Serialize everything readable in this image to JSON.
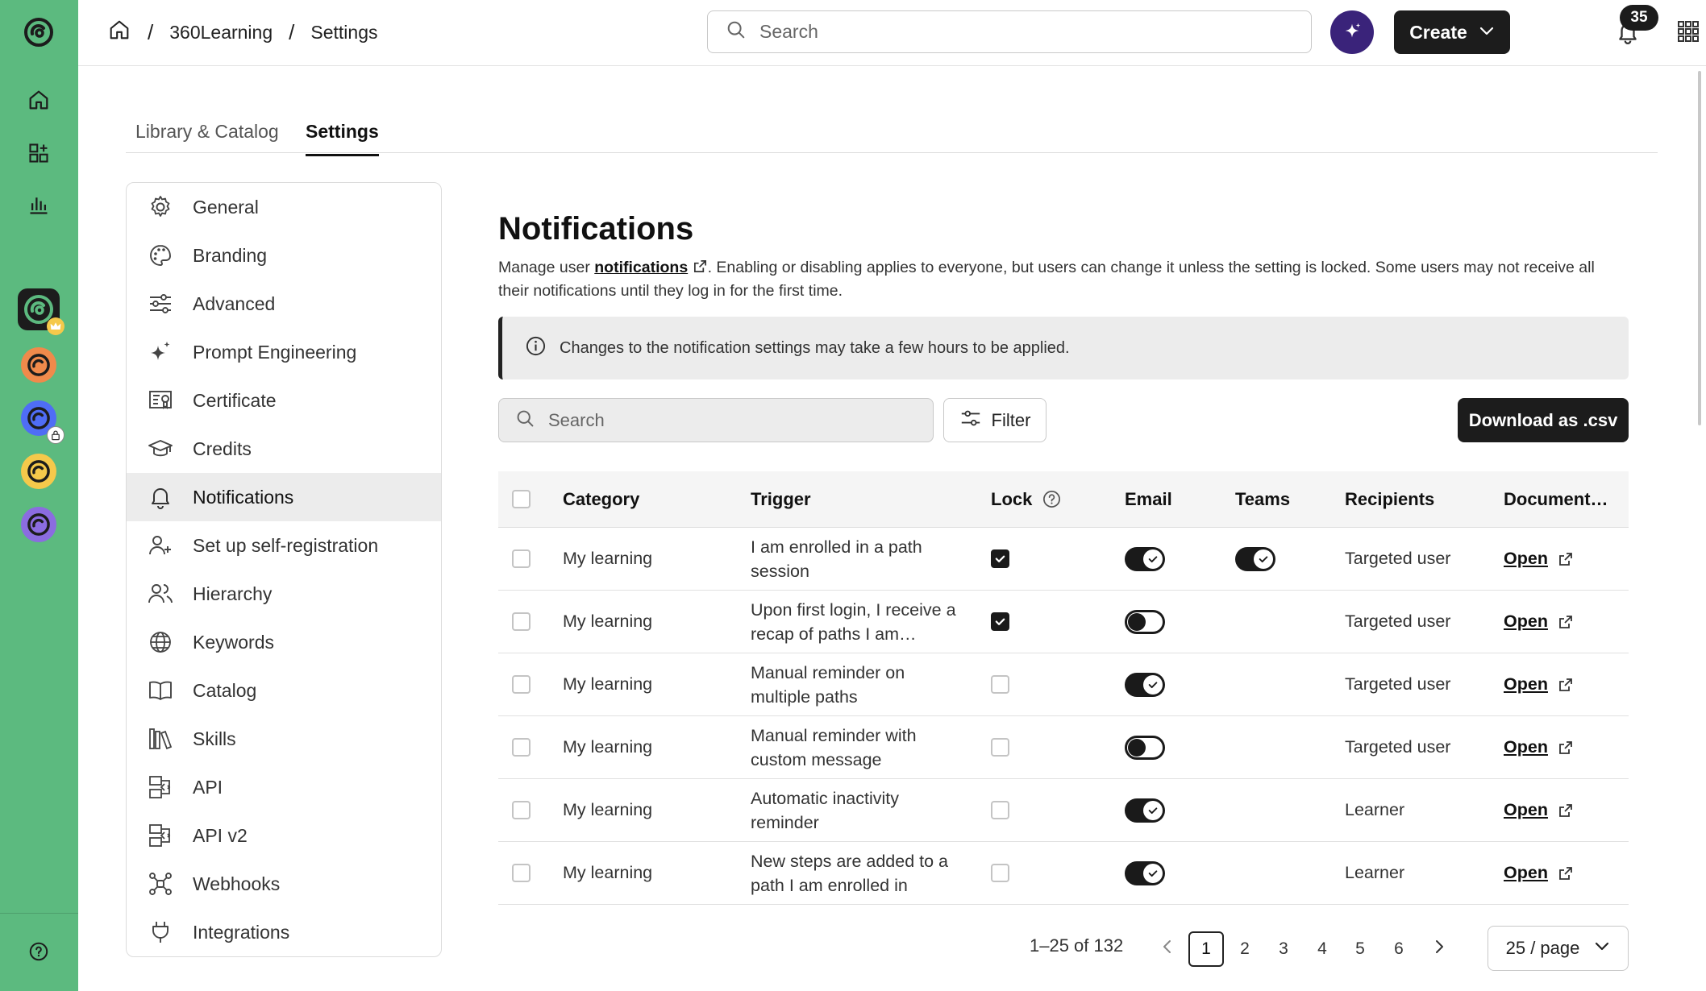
{
  "rail": {
    "icons": [
      "home-icon",
      "catalog-icon",
      "analytics-icon"
    ],
    "workspaces": [
      {
        "color": "#1c1c1c",
        "fg": "#5cba7f",
        "badge": "crown-icon",
        "active": true
      },
      {
        "color": "#f08a4b",
        "fg": "#1c1c1c"
      },
      {
        "color": "#4f6df5",
        "fg": "#1c1c1c",
        "badge": "lock-icon"
      },
      {
        "color": "#f5c94b",
        "fg": "#1c1c1c"
      },
      {
        "color": "#8b6ce0",
        "fg": "#1c1c1c"
      }
    ],
    "help_icon": "help-icon"
  },
  "topbar": {
    "breadcrumb": [
      "360Learning",
      "Settings"
    ],
    "search_placeholder": "Search",
    "create_label": "Create",
    "notification_count": "35"
  },
  "tabs": [
    "Library & Catalog",
    "Settings"
  ],
  "settings_nav": [
    {
      "label": "General",
      "icon": "gear-icon"
    },
    {
      "label": "Branding",
      "icon": "palette-icon"
    },
    {
      "label": "Advanced",
      "icon": "sliders-icon"
    },
    {
      "label": "Prompt Engineering",
      "icon": "sparkle-icon"
    },
    {
      "label": "Certificate",
      "icon": "certificate-icon"
    },
    {
      "label": "Credits",
      "icon": "graduation-cap-icon"
    },
    {
      "label": "Notifications",
      "icon": "bell-icon",
      "active": true
    },
    {
      "label": "Set up self-registration",
      "icon": "user-plus-icon"
    },
    {
      "label": "Hierarchy",
      "icon": "users-icon"
    },
    {
      "label": "Keywords",
      "icon": "globe-icon"
    },
    {
      "label": "Catalog",
      "icon": "book-icon"
    },
    {
      "label": "Skills",
      "icon": "books-icon"
    },
    {
      "label": "API",
      "icon": "api-icon"
    },
    {
      "label": "API v2",
      "icon": "api-icon"
    },
    {
      "label": "Webhooks",
      "icon": "webhook-icon"
    },
    {
      "label": "Integrations",
      "icon": "plug-icon"
    }
  ],
  "main": {
    "title": "Notifications",
    "desc_pre": "Manage user ",
    "desc_link": "notifications",
    "desc_post": ". Enabling or disabling applies to everyone, but users can change it unless the setting is locked. Some users may not receive all their notifications until they log in for the first time.",
    "banner": "Changes to the notification settings may take a few hours to be applied.",
    "search_placeholder": "Search",
    "filter_label": "Filter",
    "download_label": "Download as .csv"
  },
  "table": {
    "headers": {
      "category": "Category",
      "trigger": "Trigger",
      "lock": "Lock",
      "email": "Email",
      "teams": "Teams",
      "recipients": "Recipients",
      "document": "Document…"
    },
    "rows": [
      {
        "category": "My learning",
        "trigger": "I am enrolled in a path session",
        "lock": true,
        "email": true,
        "teams": true,
        "recipients": "Targeted user",
        "doc": "Open"
      },
      {
        "category": "My learning",
        "trigger": "Upon first login, I receive a recap of paths I am…",
        "lock": true,
        "email": false,
        "teams": null,
        "recipients": "Targeted user",
        "doc": "Open"
      },
      {
        "category": "My learning",
        "trigger": "Manual reminder on multiple paths",
        "lock": false,
        "email": true,
        "teams": null,
        "recipients": "Targeted user",
        "doc": "Open"
      },
      {
        "category": "My learning",
        "trigger": "Manual reminder with custom message",
        "lock": false,
        "email": false,
        "teams": null,
        "recipients": "Targeted user",
        "doc": "Open"
      },
      {
        "category": "My learning",
        "trigger": "Automatic inactivity reminder",
        "lock": false,
        "email": true,
        "teams": null,
        "recipients": "Learner",
        "doc": "Open"
      },
      {
        "category": "My learning",
        "trigger": "New steps are added to a path I am enrolled in",
        "lock": false,
        "email": true,
        "teams": null,
        "recipients": "Learner",
        "doc": "Open"
      }
    ]
  },
  "pagination": {
    "range": "1–25 of 132",
    "pages": [
      "1",
      "2",
      "3",
      "4",
      "5",
      "6"
    ],
    "current": "1",
    "per_page": "25 / page"
  }
}
